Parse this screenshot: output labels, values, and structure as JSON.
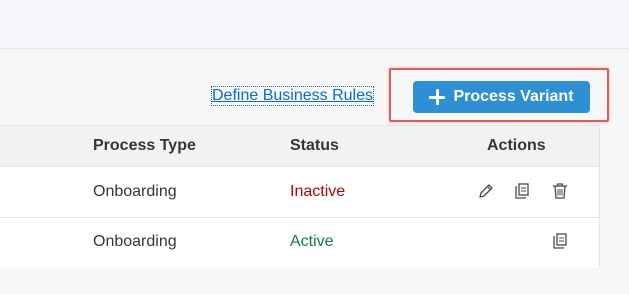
{
  "toolbar": {
    "define_rules_link": "Define Business Rules",
    "add_button_label": "Process Variant",
    "add_button_icon": "plus-icon"
  },
  "colors": {
    "accent": "#2f8fd4",
    "link": "#0a6ed1",
    "highlight": "#e15b5b",
    "inactive": "#bb0000",
    "active": "#107e3e"
  },
  "table": {
    "headers": {
      "process_type": "Process Type",
      "status": "Status",
      "actions": "Actions"
    },
    "rows": [
      {
        "process_type": "Onboarding",
        "status": "Inactive",
        "actions": [
          "edit-icon",
          "copy-icon",
          "delete-icon"
        ]
      },
      {
        "process_type": "Onboarding",
        "status": "Active",
        "actions": [
          "copy-icon"
        ]
      }
    ]
  }
}
